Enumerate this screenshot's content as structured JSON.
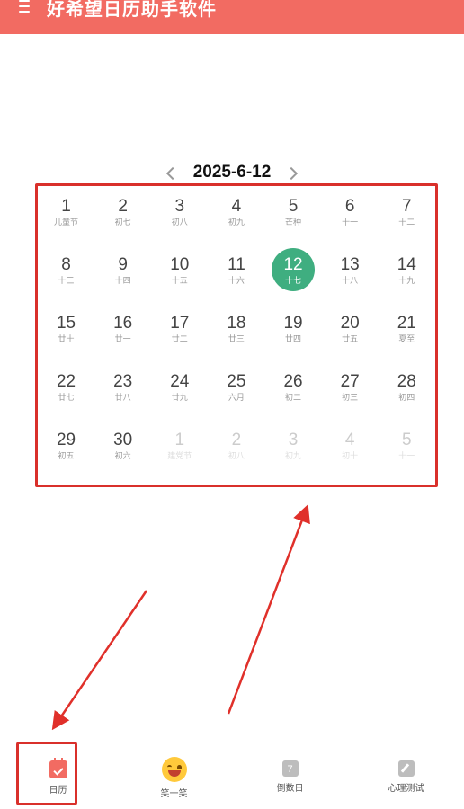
{
  "appbar": {
    "title": "好希望日历助手软件"
  },
  "nav": {
    "current_date": "2025-6-12"
  },
  "calendar": {
    "days": [
      {
        "day": "1",
        "lunar": "儿童节",
        "other": false
      },
      {
        "day": "2",
        "lunar": "初七",
        "other": false
      },
      {
        "day": "3",
        "lunar": "初八",
        "other": false
      },
      {
        "day": "4",
        "lunar": "初九",
        "other": false
      },
      {
        "day": "5",
        "lunar": "芒种",
        "other": false
      },
      {
        "day": "6",
        "lunar": "十一",
        "other": false
      },
      {
        "day": "7",
        "lunar": "十二",
        "other": false
      },
      {
        "day": "8",
        "lunar": "十三",
        "other": false
      },
      {
        "day": "9",
        "lunar": "十四",
        "other": false
      },
      {
        "day": "10",
        "lunar": "十五",
        "other": false
      },
      {
        "day": "11",
        "lunar": "十六",
        "other": false
      },
      {
        "day": "12",
        "lunar": "十七",
        "other": false,
        "selected": true
      },
      {
        "day": "13",
        "lunar": "十八",
        "other": false
      },
      {
        "day": "14",
        "lunar": "十九",
        "other": false
      },
      {
        "day": "15",
        "lunar": "廿十",
        "other": false
      },
      {
        "day": "16",
        "lunar": "廿一",
        "other": false
      },
      {
        "day": "17",
        "lunar": "廿二",
        "other": false
      },
      {
        "day": "18",
        "lunar": "廿三",
        "other": false
      },
      {
        "day": "19",
        "lunar": "廿四",
        "other": false
      },
      {
        "day": "20",
        "lunar": "廿五",
        "other": false
      },
      {
        "day": "21",
        "lunar": "夏至",
        "other": false
      },
      {
        "day": "22",
        "lunar": "廿七",
        "other": false
      },
      {
        "day": "23",
        "lunar": "廿八",
        "other": false
      },
      {
        "day": "24",
        "lunar": "廿九",
        "other": false
      },
      {
        "day": "25",
        "lunar": "六月",
        "other": false
      },
      {
        "day": "26",
        "lunar": "初二",
        "other": false
      },
      {
        "day": "27",
        "lunar": "初三",
        "other": false
      },
      {
        "day": "28",
        "lunar": "初四",
        "other": false
      },
      {
        "day": "29",
        "lunar": "初五",
        "other": false
      },
      {
        "day": "30",
        "lunar": "初六",
        "other": false
      },
      {
        "day": "1",
        "lunar": "建党节",
        "other": true
      },
      {
        "day": "2",
        "lunar": "初八",
        "other": true
      },
      {
        "day": "3",
        "lunar": "初九",
        "other": true
      },
      {
        "day": "4",
        "lunar": "初十",
        "other": true
      },
      {
        "day": "5",
        "lunar": "十一",
        "other": true
      }
    ]
  },
  "tabs": [
    {
      "label": "日历",
      "icon": "calendar-icon"
    },
    {
      "label": "笑一笑",
      "icon": "smile-icon"
    },
    {
      "label": "倒数日",
      "icon": "countdown-icon",
      "icon_text": "7"
    },
    {
      "label": "心理测试",
      "icon": "test-icon"
    }
  ],
  "colors": {
    "accent": "#f26b62",
    "selected": "#3fae80",
    "highlight": "#d9302b"
  }
}
